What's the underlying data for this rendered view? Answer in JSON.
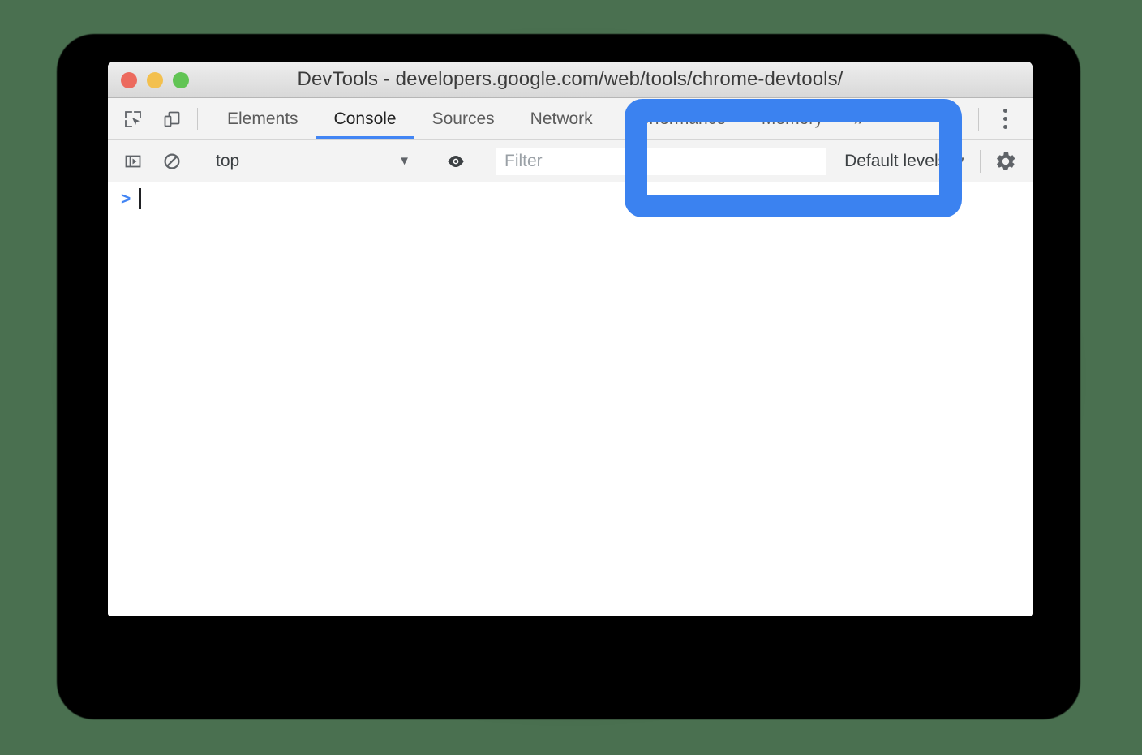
{
  "window": {
    "title": "DevTools - developers.google.com/web/tools/chrome-devtools/",
    "traffic_lights": [
      {
        "name": "close",
        "color": "#ec6a5e"
      },
      {
        "name": "minimize",
        "color": "#f3c04e"
      },
      {
        "name": "zoom",
        "color": "#61c454"
      }
    ]
  },
  "tabbar": {
    "icons": [
      {
        "name": "inspect-element-icon",
        "label": "Inspect element"
      },
      {
        "name": "device-toolbar-icon",
        "label": "Toggle device toolbar"
      }
    ],
    "tabs": [
      {
        "label": "Elements",
        "active": false
      },
      {
        "label": "Console",
        "active": true
      },
      {
        "label": "Sources",
        "active": false
      },
      {
        "label": "Network",
        "active": false
      },
      {
        "label": "Performance",
        "active": false
      },
      {
        "label": "Memory",
        "active": false
      }
    ],
    "more_tabs_label": "»",
    "menu_label": "Customize and control DevTools",
    "active_tab_color": "#4285f4"
  },
  "filterbar": {
    "sidebar_toggle_label": "Show console sidebar",
    "clear_console_label": "Clear console",
    "context": {
      "value": "top",
      "caret": "▼"
    },
    "live_expression_label": "Create live expression",
    "filter": {
      "placeholder": "Filter",
      "value": ""
    },
    "levels": {
      "label": "Default levels",
      "caret": "▼"
    },
    "settings_label": "Console settings"
  },
  "console": {
    "prompt_chevron": ">",
    "input_value": ""
  },
  "annotation": {
    "name": "highlight-rectangle",
    "color": "#3b82f0"
  },
  "page": {
    "background_color": "#4a7050"
  }
}
